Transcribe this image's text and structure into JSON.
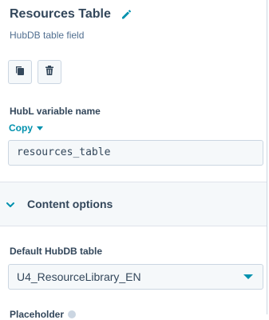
{
  "header": {
    "title": "Resources Table",
    "subtitle": "HubDB table field",
    "edit_icon": "pencil-icon"
  },
  "actions": {
    "copy_icon": "copy-icon",
    "delete_icon": "trash-icon"
  },
  "hubl": {
    "label": "HubL variable name",
    "copy_label": "Copy",
    "value": "resources_table"
  },
  "content_options": {
    "label": "Content options",
    "icon": "chevron-down-icon"
  },
  "default_table": {
    "label": "Default HubDB table",
    "selected": "U4_ResourceLibrary_EN"
  },
  "placeholder": {
    "label": "Placeholder",
    "help_icon": "help-icon"
  },
  "colors": {
    "accent": "#0091ae",
    "text": "#33475b",
    "border": "#cbd6e2",
    "field_bg": "#f5f8fa"
  }
}
